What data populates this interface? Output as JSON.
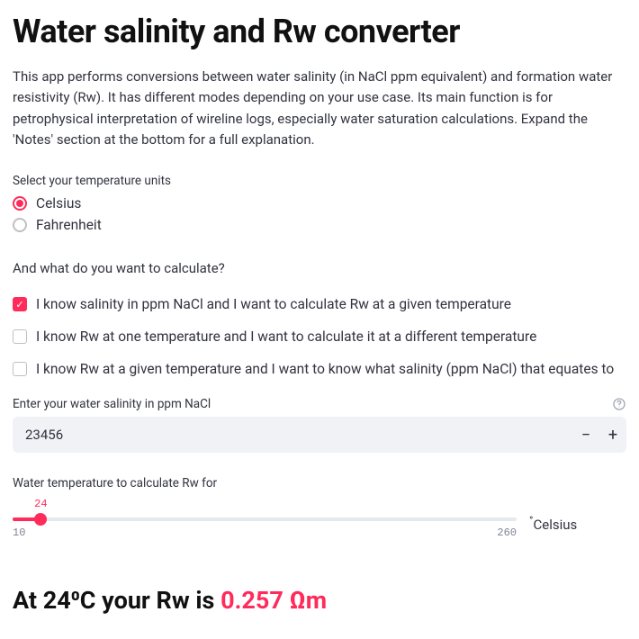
{
  "title": "Water salinity and Rw converter",
  "intro": "This app performs conversions between water salinity (in NaCl ppm equivalent) and formation water resistivity (Rw). It has different modes depending on your use case. Its main function is for petrophysical interpretation of wireline logs, especially water saturation calculations. Expand the 'Notes' section at the bottom for a full explanation.",
  "temp_units": {
    "label": "Select your temperature units",
    "options": {
      "celsius": "Celsius",
      "fahrenheit": "Fahrenheit"
    },
    "selected": "celsius"
  },
  "calc_question": "And what do you want to calculate?",
  "calc_options": {
    "opt1": "I know salinity in ppm NaCl and I want to calculate Rw at a given temperature",
    "opt2": "I know Rw at one temperature and I want to calculate it at a different temperature",
    "opt3": "I know Rw at a given temperature and I want to know what salinity (ppm NaCl) that equates to"
  },
  "salinity_input": {
    "label": "Enter your water salinity in ppm NaCl",
    "value": "23456"
  },
  "temp_slider": {
    "label": "Water temperature to calculate Rw for",
    "value": "24",
    "min": "10",
    "max": "260",
    "unit_prefix": "°",
    "unit_name": "Celsius"
  },
  "result": {
    "prefix": "At 24⁰C your Rw is ",
    "value": "0.257 Ωm"
  }
}
